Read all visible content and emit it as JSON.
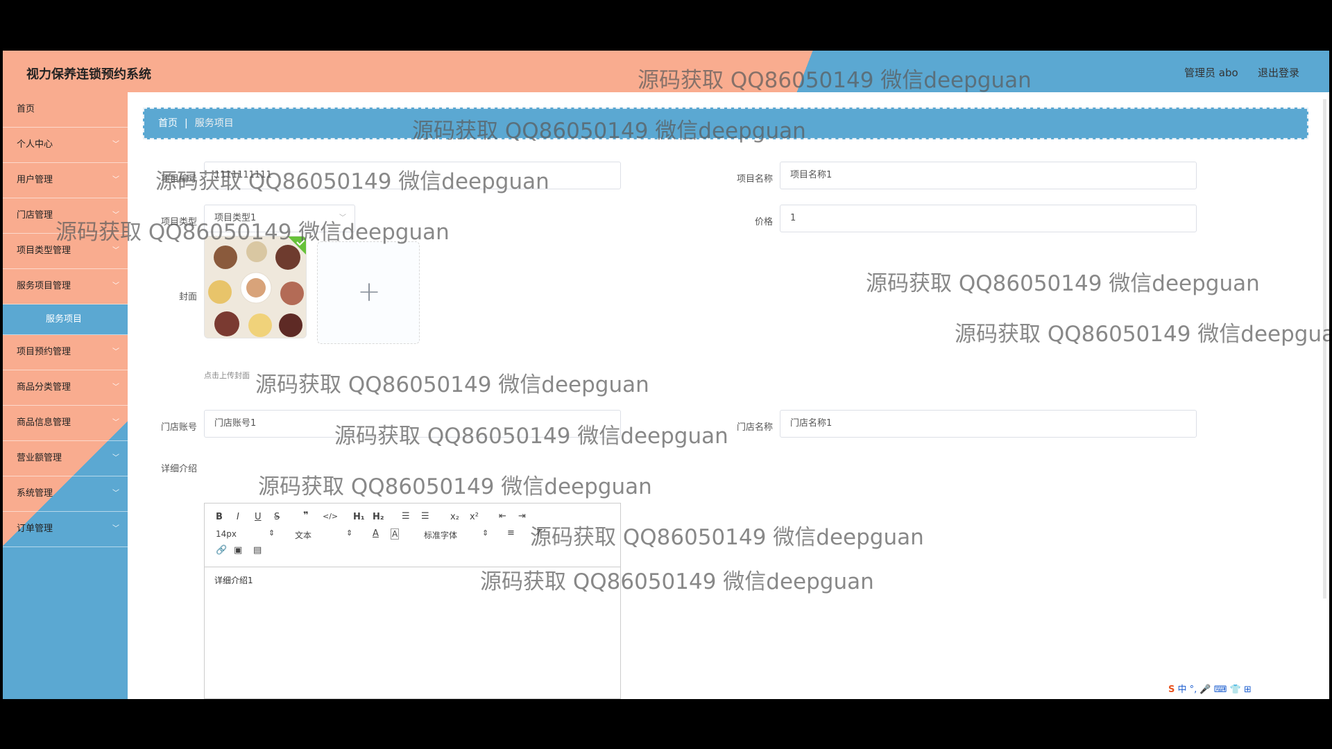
{
  "header": {
    "title": "视力保养连锁预约系统",
    "admin_label": "管理员 abo",
    "logout": "退出登录"
  },
  "sidebar": {
    "items": [
      {
        "label": "首页",
        "has_chevron": false
      },
      {
        "label": "个人中心",
        "has_chevron": true
      },
      {
        "label": "用户管理",
        "has_chevron": true
      },
      {
        "label": "门店管理",
        "has_chevron": true
      },
      {
        "label": "项目类型管理",
        "has_chevron": true
      },
      {
        "label": "服务项目管理",
        "has_chevron": true
      },
      {
        "label": "项目预约管理",
        "has_chevron": true
      },
      {
        "label": "商品分类管理",
        "has_chevron": true
      },
      {
        "label": "商品信息管理",
        "has_chevron": true
      },
      {
        "label": "营业额管理",
        "has_chevron": true
      },
      {
        "label": "系统管理",
        "has_chevron": true
      },
      {
        "label": "订单管理",
        "has_chevron": true
      }
    ],
    "active_sub": "服务项目"
  },
  "breadcrumb": {
    "home": "首页",
    "current": "服务项目"
  },
  "form": {
    "item_no_label": "项目编号",
    "item_no_value": "1111111111",
    "item_name_label": "项目名称",
    "item_name_value": "项目名称1",
    "item_type_label": "项目类型",
    "item_type_value": "项目类型1",
    "price_label": "价格",
    "price_value": "1",
    "cover_label": "封面",
    "upload_tip": "点击上传封面",
    "store_account_label": "门店账号",
    "store_account_value": "门店账号1",
    "store_name_label": "门店名称",
    "store_name_value": "门店名称1",
    "detail_label": "详细介绍"
  },
  "editor": {
    "font_size": "14px",
    "text_type": "文本",
    "font_family": "标准字体",
    "content": "详细介绍1"
  },
  "watermark": "源码获取 QQ86050149 微信deepguan",
  "ime": "中 °, 🎤 ⌨ 👕 ⊞",
  "colors": {
    "peach": "#f9ac8f",
    "blue": "#5ba8d2"
  }
}
